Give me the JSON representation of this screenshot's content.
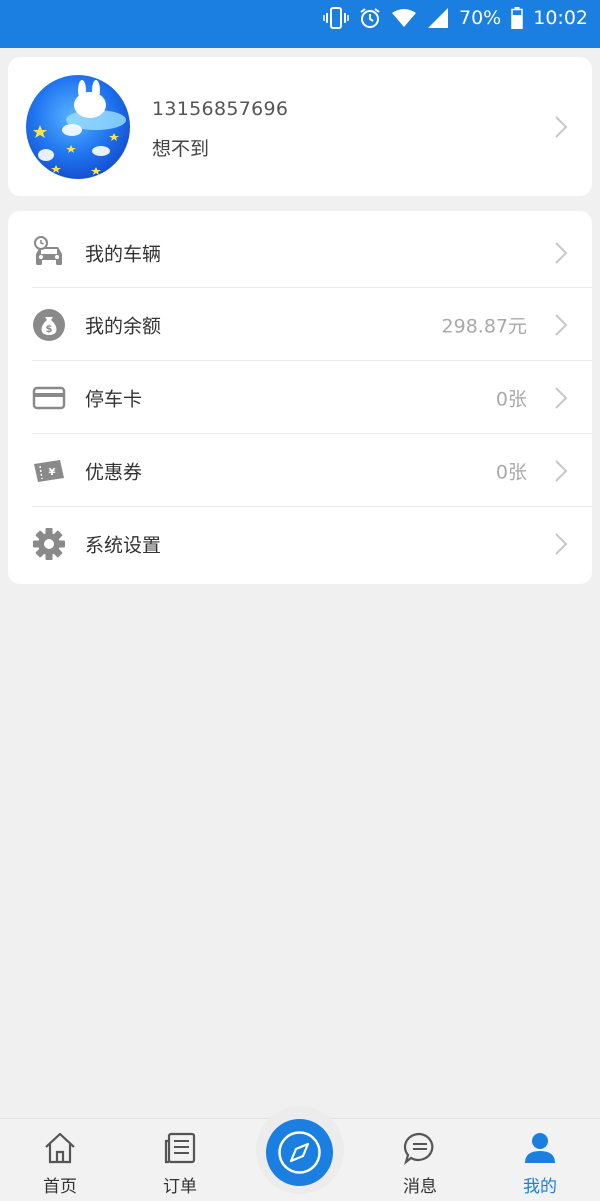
{
  "status_bar": {
    "battery_percent": "70%",
    "time": "10:02",
    "icons": [
      "vibrate-icon",
      "alarm-icon",
      "wifi-icon",
      "signal-icon",
      "battery-icon"
    ]
  },
  "profile": {
    "phone": "13156857696",
    "nickname": "想不到"
  },
  "menu": {
    "items": [
      {
        "icon": "car-icon",
        "label": "我的车辆",
        "value": ""
      },
      {
        "icon": "money-bag-icon",
        "label": "我的余额",
        "value": "298.87元"
      },
      {
        "icon": "card-icon",
        "label": "停车卡",
        "value": "0张"
      },
      {
        "icon": "coupon-icon",
        "label": "优惠券",
        "value": "0张"
      },
      {
        "icon": "gear-icon",
        "label": "系统设置",
        "value": ""
      }
    ]
  },
  "bottom_nav": {
    "items": [
      {
        "icon": "home-icon",
        "label": "首页"
      },
      {
        "icon": "orders-icon",
        "label": "订单"
      },
      {
        "icon": "compass-icon",
        "label": ""
      },
      {
        "icon": "message-icon",
        "label": "消息"
      },
      {
        "icon": "user-icon",
        "label": "我的"
      }
    ],
    "active_index": 4
  },
  "colors": {
    "accent": "#1a7fe0",
    "background": "#f0f0f0",
    "card": "#ffffff",
    "text_primary": "#333333",
    "text_secondary": "#aaaaaa"
  }
}
